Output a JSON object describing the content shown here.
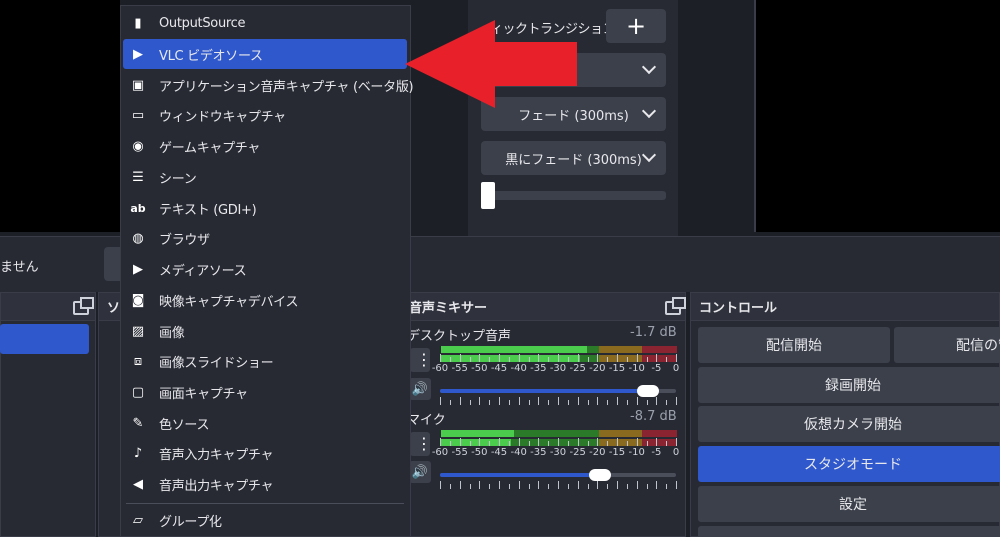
{
  "menu": {
    "items": [
      {
        "label": "OutputSource",
        "icon": "file-icon"
      },
      {
        "label": "VLC ビデオソース",
        "icon": "play-icon"
      },
      {
        "label": "アプリケーション音声キャプチャ (ベータ版)",
        "icon": "app-audio-icon"
      },
      {
        "label": "ウィンドウキャプチャ",
        "icon": "window-icon"
      },
      {
        "label": "ゲームキャプチャ",
        "icon": "gamepad-icon"
      },
      {
        "label": "シーン",
        "icon": "list-icon"
      },
      {
        "label": "テキスト (GDI+)",
        "icon": "text-icon"
      },
      {
        "label": "ブラウザ",
        "icon": "globe-icon"
      },
      {
        "label": "メディアソース",
        "icon": "play-icon"
      },
      {
        "label": "映像キャプチャデバイス",
        "icon": "camera-icon"
      },
      {
        "label": "画像",
        "icon": "image-icon"
      },
      {
        "label": "画像スライドショー",
        "icon": "slideshow-icon"
      },
      {
        "label": "画面キャプチャ",
        "icon": "monitor-icon"
      },
      {
        "label": "色ソース",
        "icon": "brush-icon"
      },
      {
        "label": "音声入力キャプチャ",
        "icon": "microphone-icon"
      },
      {
        "label": "音声出力キャプチャ",
        "icon": "speaker-icon"
      },
      {
        "label": "グループ化",
        "icon": "folder-icon"
      }
    ]
  },
  "transitions": {
    "quick_label": "ィックトランジション",
    "add": "+",
    "select_fade": "フェード (300ms)",
    "select_black_fade": "黒にフェード (300ms)"
  },
  "mid": {
    "text": "ません"
  },
  "sources_dock": {
    "title": "ソ"
  },
  "mixer": {
    "title": "音声ミキサー",
    "channels": [
      {
        "name": "デスクトップ音声",
        "db": "-1.7 dB",
        "level": 0.62,
        "volume": 0.88
      },
      {
        "name": "マイク",
        "db": "-8.7 dB",
        "level": 0.31,
        "volume": 0.68
      }
    ],
    "scale": [
      "-60",
      "-55",
      "-50",
      "-45",
      "-40",
      "-35",
      "-30",
      "-25",
      "-20",
      "-15",
      "-10",
      "-5",
      "0"
    ]
  },
  "controls": {
    "title": "コントロール",
    "start_stream": "配信開始",
    "stream_settings": "配信の管",
    "start_recording": "録画開始",
    "start_virtual_cam": "仮想カメラ開始",
    "studio_mode": "スタジオモード",
    "settings": "設定"
  },
  "colors": {
    "accent": "#2f58cc",
    "arrow": "#e8202a"
  }
}
